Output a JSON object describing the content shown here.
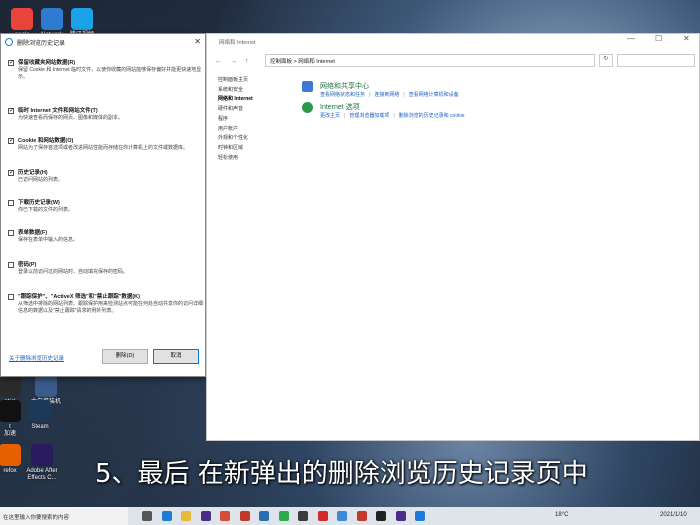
{
  "desktop": {
    "icons_top": [
      {
        "label": "oogle",
        "color": "#e8443a"
      },
      {
        "label": "Network",
        "color": "#2e7bcf"
      },
      {
        "label": "腾讯视频",
        "color": "#1aa3e8"
      }
    ],
    "icons_bottom": [
      {
        "label": "ntial\no Code",
        "color": "#2b2b2b"
      },
      {
        "label": "大白菜装机\n版",
        "color": "#3a5c8a"
      },
      {
        "label": "t\n加速",
        "color": "#111111"
      },
      {
        "label": "Steam",
        "color": "#1b3a5a"
      },
      {
        "label": "refox",
        "color": "#e66000"
      },
      {
        "label": "Adobe After\nEffects C...",
        "color": "#2a1b5e"
      }
    ]
  },
  "dialog": {
    "title": "删除浏览历史记录",
    "close_glyph": "✕",
    "options": [
      {
        "checked": true,
        "title": "保留收藏夹网站数据(R)",
        "desc": "保留 Cookie 和 Internet 临时文件，以使你收藏的网站能够保存偏好并能更快速地显示。"
      },
      {
        "checked": true,
        "title": "临时 Internet 文件和网站文件(T)",
        "desc": "为快速查看而保存的网页、图像和媒体的副本。"
      },
      {
        "checked": true,
        "title": "Cookie 和网站数据(O)",
        "desc": "网站为了保存首选项或者改进网站性能而存储在你计算机上的文件或数据库。"
      },
      {
        "checked": true,
        "title": "历史记录(H)",
        "desc": "已访问网站的列表。"
      },
      {
        "checked": false,
        "title": "下载历史记录(W)",
        "desc": "你已下载的文件的列表。"
      },
      {
        "checked": false,
        "title": "表单数据(F)",
        "desc": "保存在表单中输入的信息。"
      },
      {
        "checked": false,
        "title": "密码(P)",
        "desc": "登录以前访问过的网站时，自动填充保存的密码。"
      },
      {
        "checked": false,
        "title": "\"跟踪保护\"、\"ActiveX 筛选\"和\"禁止跟踪\"数据(K)",
        "desc": "从筛选中排除的网站列表、跟踪保护用来检测站点可能在何处自动共享你的访问详细信息的数据以及\"禁止跟踪\"请求的例外列表。"
      }
    ],
    "link": "关于删除浏览历史记录",
    "delete_button": "删除(D)",
    "cancel_button": "取消"
  },
  "explorer": {
    "title": "网络和 Internet",
    "address": "控制面板 > 网络和 Internet",
    "nav": [
      "←",
      "→",
      "↑"
    ],
    "refresh": "↻",
    "window_controls": [
      "—",
      "☐",
      "✕"
    ],
    "left_nav": [
      {
        "label": "控制面板主页",
        "bold": false
      },
      {
        "label": "",
        "bold": false
      },
      {
        "label": "系统和安全",
        "bold": false
      },
      {
        "label": "网络和 Internet",
        "bold": true
      },
      {
        "label": "硬件和声音",
        "bold": false
      },
      {
        "label": "程序",
        "bold": false
      },
      {
        "label": "用户帐户",
        "bold": false
      },
      {
        "label": "外观和个性化",
        "bold": false
      },
      {
        "label": "时钟和区域",
        "bold": false
      },
      {
        "label": "轻松使用",
        "bold": false
      }
    ],
    "sections": [
      {
        "title": "网络和共享中心",
        "links": [
          "查看网络状态和任务",
          "连接到网络",
          "查看网络计算机和设备"
        ],
        "icon_color": "#3c7ad6"
      },
      {
        "title": "Internet 选项",
        "links": [
          "更改主页",
          "管理浏览器加载项",
          "删除浏览的历史记录和 cookie"
        ],
        "icon_color": "#2a9a4a"
      }
    ]
  },
  "subtitle": "5、最后 在新弹出的删除浏览历史记录页中",
  "taskbar": {
    "search_placeholder": "在这里输入你要搜索的内容",
    "apps": [
      {
        "name": "task-view",
        "color": "#555555"
      },
      {
        "name": "edge",
        "color": "#1f7ad1"
      },
      {
        "name": "explorer",
        "color": "#e8b93a"
      },
      {
        "name": "premiere",
        "color": "#4a2d8a"
      },
      {
        "name": "chrome",
        "color": "#d84a3a"
      },
      {
        "name": "app-a",
        "color": "#c03a2a"
      },
      {
        "name": "photoshop",
        "color": "#2a6fb0"
      },
      {
        "name": "wechat",
        "color": "#2aaa4a"
      },
      {
        "name": "app-b",
        "color": "#3a3a3a"
      },
      {
        "name": "netease-music",
        "color": "#d02a2a"
      },
      {
        "name": "app-c",
        "color": "#3a8ad6"
      },
      {
        "name": "wps",
        "color": "#c0392b"
      },
      {
        "name": "app-d",
        "color": "#222222"
      },
      {
        "name": "after-effects",
        "color": "#4a2d8a"
      },
      {
        "name": "ie",
        "color": "#1e7bd8"
      }
    ],
    "weather": "18°C",
    "clock": "2021/1/10"
  }
}
